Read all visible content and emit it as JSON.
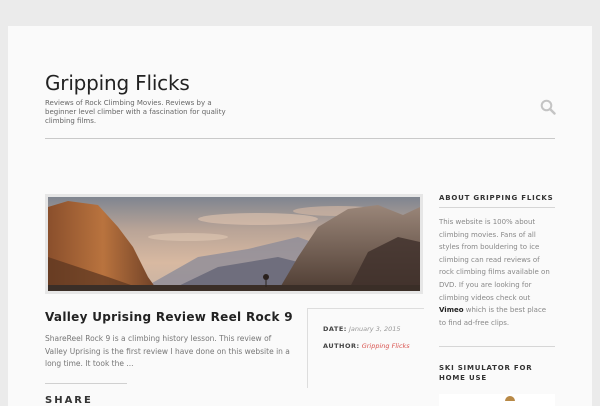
{
  "site": {
    "title": "Gripping Flicks",
    "description": "Reviews of Rock Climbing Movies. Reviews by a beginner level climber with a fascination for quality climbing films.",
    "search_icon": "search-icon"
  },
  "post": {
    "title": "Valley Uprising Review Reel Rock 9",
    "excerpt": "ShareReel Rock 9 is a climbing history lesson. This review of Valley Uprising is the first review I have done on this website in a long time. It took the ...",
    "share_label": "SHARE",
    "date_label": "DATE:",
    "date_value": "January 3, 2015",
    "author_label": "AUTHOR:",
    "author_value": "Gripping Flicks",
    "image_icon": "mountain-landscape-image"
  },
  "sidebar": {
    "about_heading": "ABOUT GRIPPING FLICKS",
    "about_text_before": "This website is 100% about climbing movies. Fans of all styles from bouldering to ice climbing can read reviews of rock climbing films available on DVD. If you are looking for climbing videos check out ",
    "about_link": "Vimeo",
    "about_text_after": " which is the best place to find ad-free clips.",
    "ski_heading": "SKI SIMULATOR FOR HOME USE"
  },
  "colors": {
    "accent_link": "#d9534f",
    "background": "#ebebeb",
    "page": "#fafafa"
  }
}
